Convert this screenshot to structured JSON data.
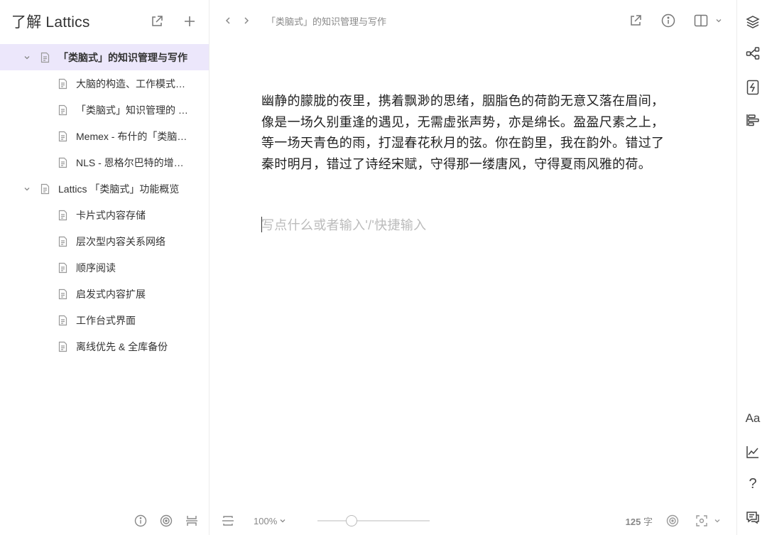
{
  "sidebar": {
    "title": "了解 Lattics",
    "tree": [
      {
        "label": "「类脑式」的知识管理与写作",
        "level": 1,
        "selected": true
      },
      {
        "label": "大脑的构造、工作模式…",
        "level": 2
      },
      {
        "label": "「类脑式」知识管理的 …",
        "level": 2
      },
      {
        "label": "Memex - 布什的「类脑…",
        "level": 2
      },
      {
        "label": "NLS - 恩格尔巴特的增…",
        "level": 2
      },
      {
        "label": "Lattics 「类脑式」功能概览",
        "level": 1
      },
      {
        "label": "卡片式内容存储",
        "level": 2
      },
      {
        "label": "层次型内容关系网络",
        "level": 2
      },
      {
        "label": "顺序阅读",
        "level": 2
      },
      {
        "label": "启发式内容扩展",
        "level": 2
      },
      {
        "label": "工作台式界面",
        "level": 2
      },
      {
        "label": "离线优先 & 全库备份",
        "level": 2
      }
    ]
  },
  "topbar": {
    "breadcrumb": "「类脑式」的知识管理与写作"
  },
  "editor": {
    "paragraph": "幽静的朦胧的夜里，携着飘渺的思绪，胭脂色的荷韵无意又落在眉间，像是一场久别重逢的遇见，无需虚张声势，亦是绵长。盈盈尺素之上，等一场天青色的雨，打湿春花秋月的弦。你在韵里，我在韵外。错过了秦时明月，错过了诗经宋赋，守得那一缕唐风，守得夏雨风雅的荷。",
    "placeholder": "写点什么或者输入'/'快捷输入"
  },
  "bottombar": {
    "zoom": "100%",
    "zoom_level": 0.3,
    "word_count": "125",
    "word_unit": "字"
  },
  "rail": {
    "font_label": "Aa",
    "help_label": "?"
  },
  "colors": {
    "selected_bg": "#ece7fb",
    "border": "#ececec"
  }
}
